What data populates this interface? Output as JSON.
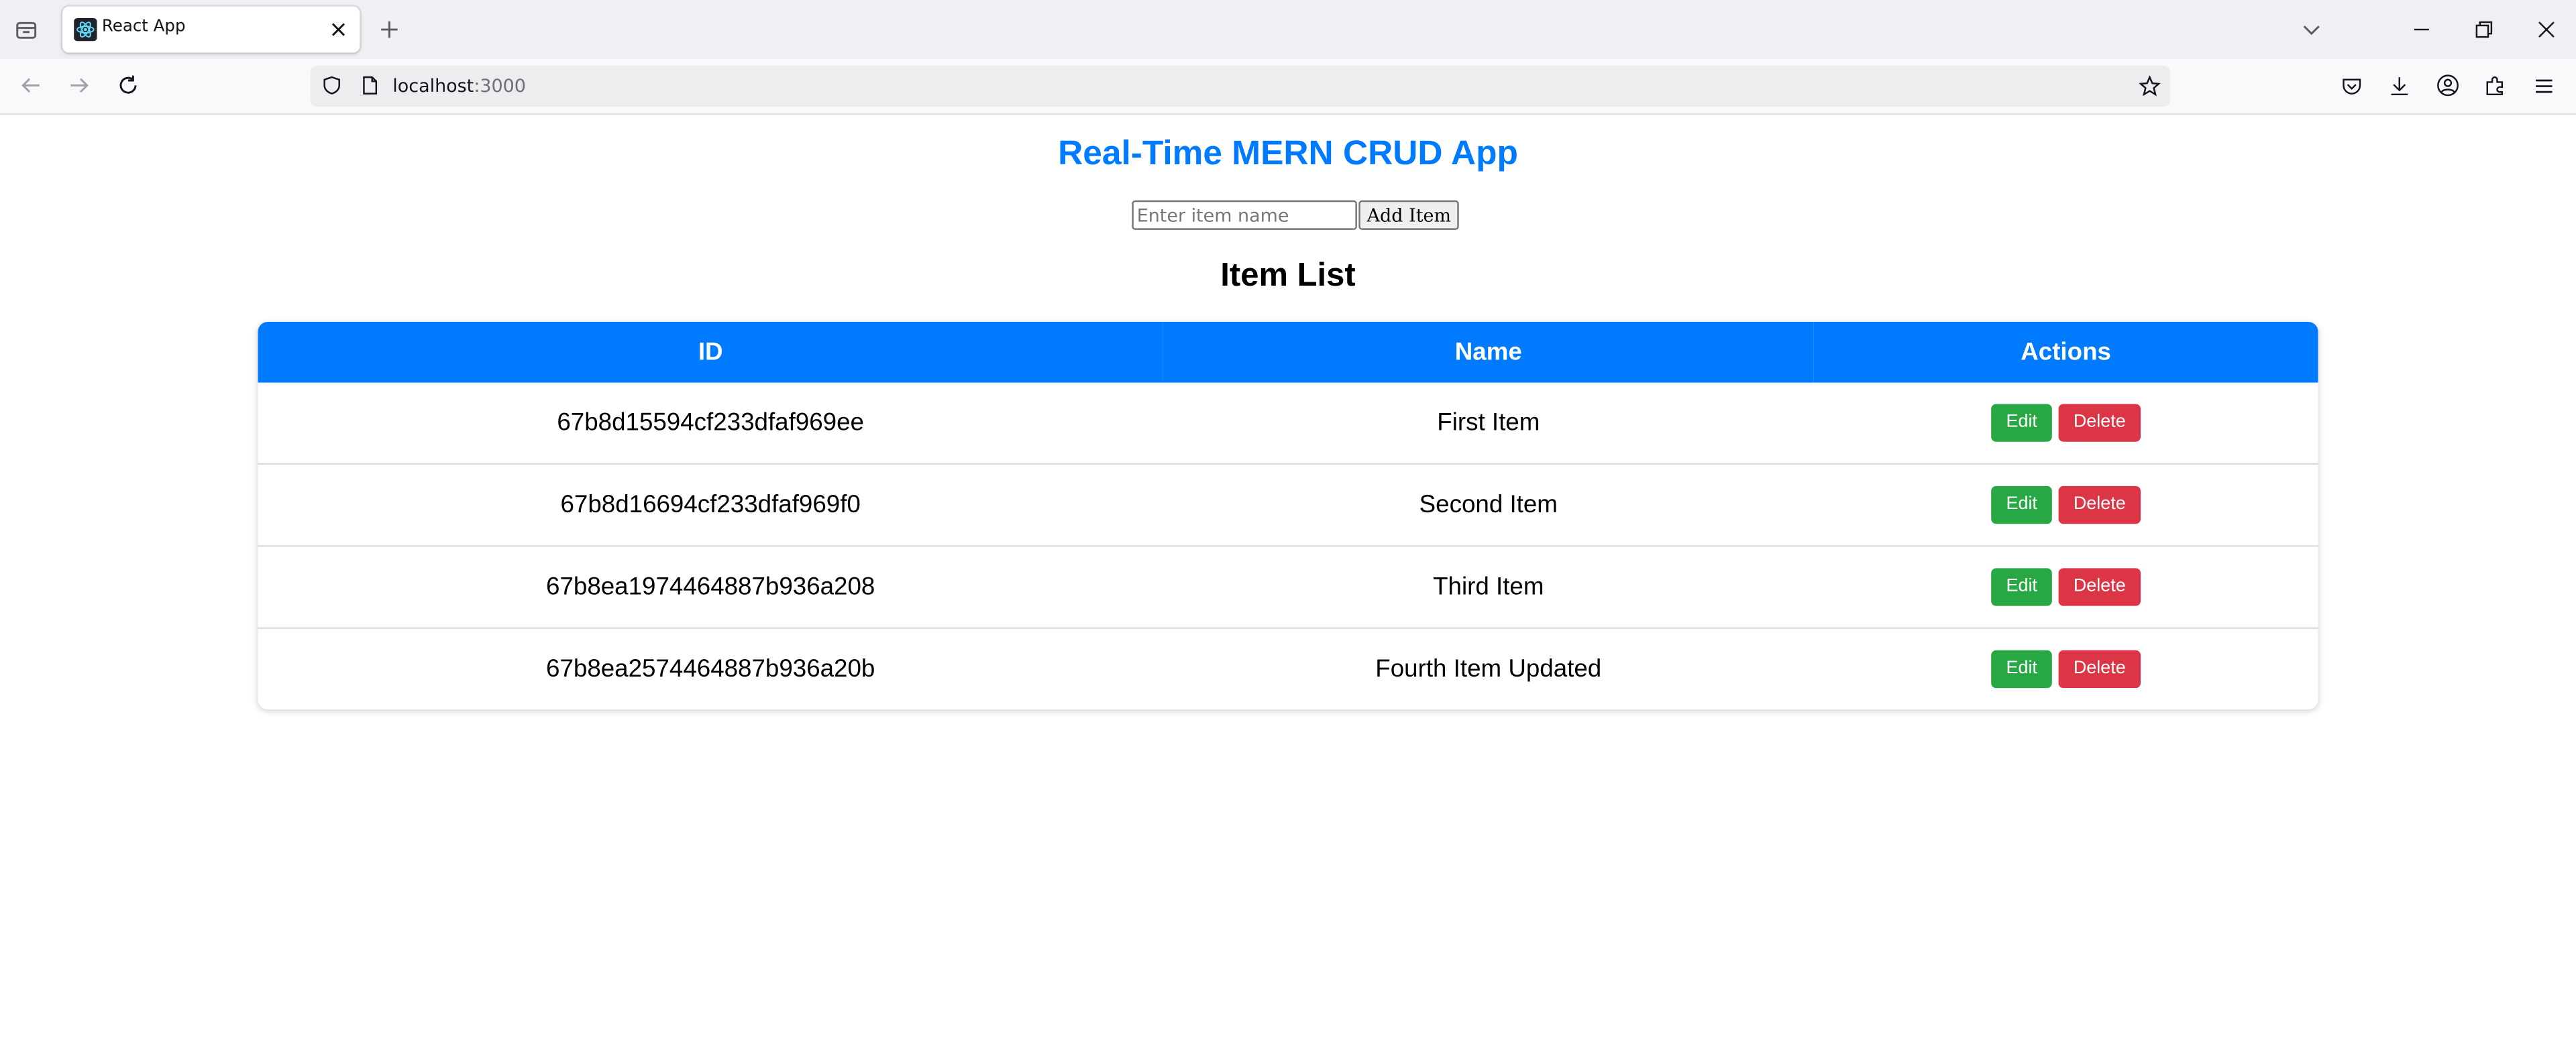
{
  "browser": {
    "tab_title": "React App",
    "url_host": "localhost",
    "url_port": ":3000",
    "icons": {
      "tab_list": "tab-list-icon",
      "favicon": "react-logo-icon",
      "close": "close-icon",
      "new_tab": "plus-icon",
      "list_all_tabs": "chevron-down-icon",
      "minimize": "minimize-icon",
      "restore": "restore-icon",
      "window_close": "close-icon",
      "back": "back-arrow-icon",
      "forward": "forward-arrow-icon",
      "reload": "reload-icon",
      "shield": "shield-icon",
      "page": "page-icon",
      "bookmark": "star-icon",
      "pocket": "pocket-icon",
      "downloads": "download-icon",
      "account": "account-icon",
      "extensions": "extensions-icon",
      "menu": "hamburger-menu-icon"
    }
  },
  "app": {
    "title": "Real-Time MERN CRUD App",
    "input_placeholder": "Enter item name",
    "input_value": "",
    "add_button_label": "Add Item",
    "list_title": "Item List",
    "accent_color": "#007bff",
    "edit_color": "#28a745",
    "delete_color": "#dc3545"
  },
  "table": {
    "headers": [
      "ID",
      "Name",
      "Actions"
    ],
    "rows": [
      {
        "id": "67b8d15594cf233dfaf969ee",
        "name": "First Item",
        "edit_label": "Edit",
        "delete_label": "Delete"
      },
      {
        "id": "67b8d16694cf233dfaf969f0",
        "name": "Second Item",
        "edit_label": "Edit",
        "delete_label": "Delete"
      },
      {
        "id": "67b8ea1974464887b936a208",
        "name": "Third Item",
        "edit_label": "Edit",
        "delete_label": "Delete"
      },
      {
        "id": "67b8ea2574464887b936a20b",
        "name": "Fourth Item Updated",
        "edit_label": "Edit",
        "delete_label": "Delete"
      }
    ]
  }
}
